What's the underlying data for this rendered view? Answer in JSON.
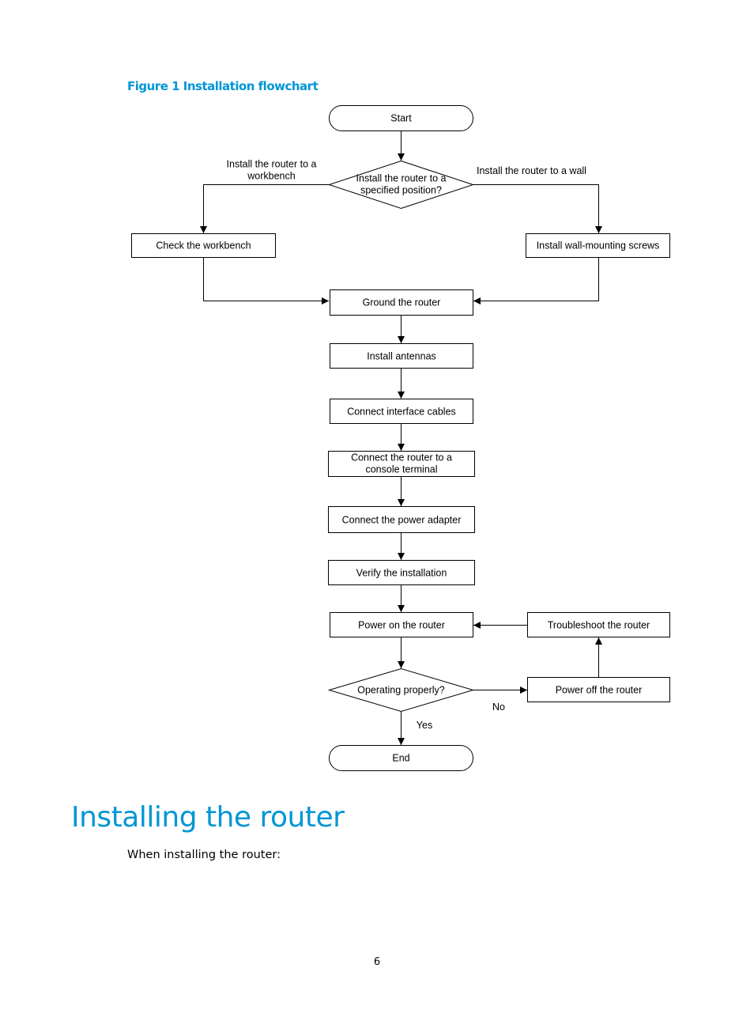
{
  "figure": {
    "caption": "Figure 1 Installation flowchart",
    "nodes": {
      "start": "Start",
      "decision_position": [
        "Install the router to a",
        "specified position?"
      ],
      "check_workbench": "Check the workbench",
      "install_screws": "Install wall-mounting screws",
      "ground": "Ground the router",
      "antennas": "Install antennas",
      "interface_cables": "Connect interface cables",
      "console": [
        "Connect the router to a",
        "console terminal"
      ],
      "power_adapter": "Connect the power adapter",
      "verify": "Verify the installation",
      "power_on": "Power on the router",
      "troubleshoot": "Troubleshoot the router",
      "decision_operating": "Operating properly?",
      "power_off": "Power off the router",
      "end": "End"
    },
    "edge_labels": {
      "workbench": [
        "Install the router to a",
        "workbench"
      ],
      "wall": "Install the router to a wall",
      "no": "No",
      "yes": "Yes"
    }
  },
  "section": {
    "title": "Installing the router",
    "intro": "When installing the router:"
  },
  "page_number": "6"
}
